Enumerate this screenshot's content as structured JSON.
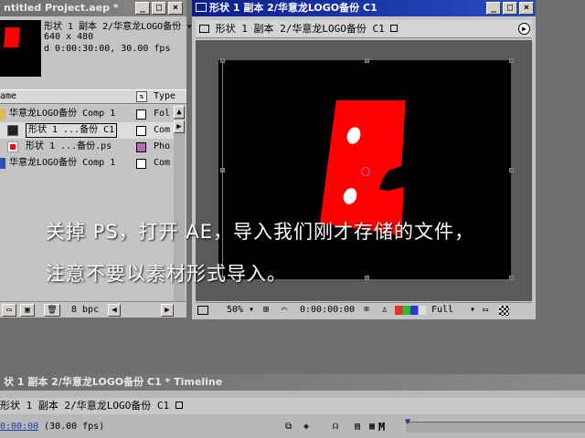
{
  "project": {
    "title": "ntitled Project.aep *",
    "selected_name": "形状 1 副本 2/华意龙LOGO备份 ▾",
    "dimensions": "640 x 480",
    "duration": "d 0:00:30:00, 30.00 fps",
    "col_name": "ame",
    "col_type": "Type",
    "items": [
      {
        "label": "华意龙LOGO备份 Comp 1",
        "type": "Fol",
        "icon": "folder-icon"
      },
      {
        "label": "形状 1 ...备份 C1",
        "type": "Com",
        "icon": "composition-icon"
      },
      {
        "label": "形状 1 ...备份.ps",
        "type": "Pho",
        "icon": "photoshop-layer-icon"
      },
      {
        "label": "华意龙LOGO备份 Comp 1",
        "type": "Com",
        "icon": "composition-icon"
      }
    ],
    "bpc": "8 bpc"
  },
  "comp": {
    "title": "形状 1 副本 2/华意龙LOGO备份 C1",
    "tab": "形状 1 副本 2/华意龙LOGO备份 C1",
    "zoom": "50%",
    "timecode": "0:00:00:00",
    "resolution": "Full"
  },
  "timeline": {
    "title": "状 1 副本 2/华意龙LOGO备份 C1 * Timeline",
    "tab": "形状 1 副本 2/华意龙LOGO备份 C1",
    "timecode": "0:00:00",
    "fps": "(30.00 fps)",
    "marker": "M"
  },
  "subtitle": {
    "line1": "关掉 PS，打开 AE，导入我们刚才存储的文件，",
    "line2": "注意不要以素材形式导入。"
  }
}
